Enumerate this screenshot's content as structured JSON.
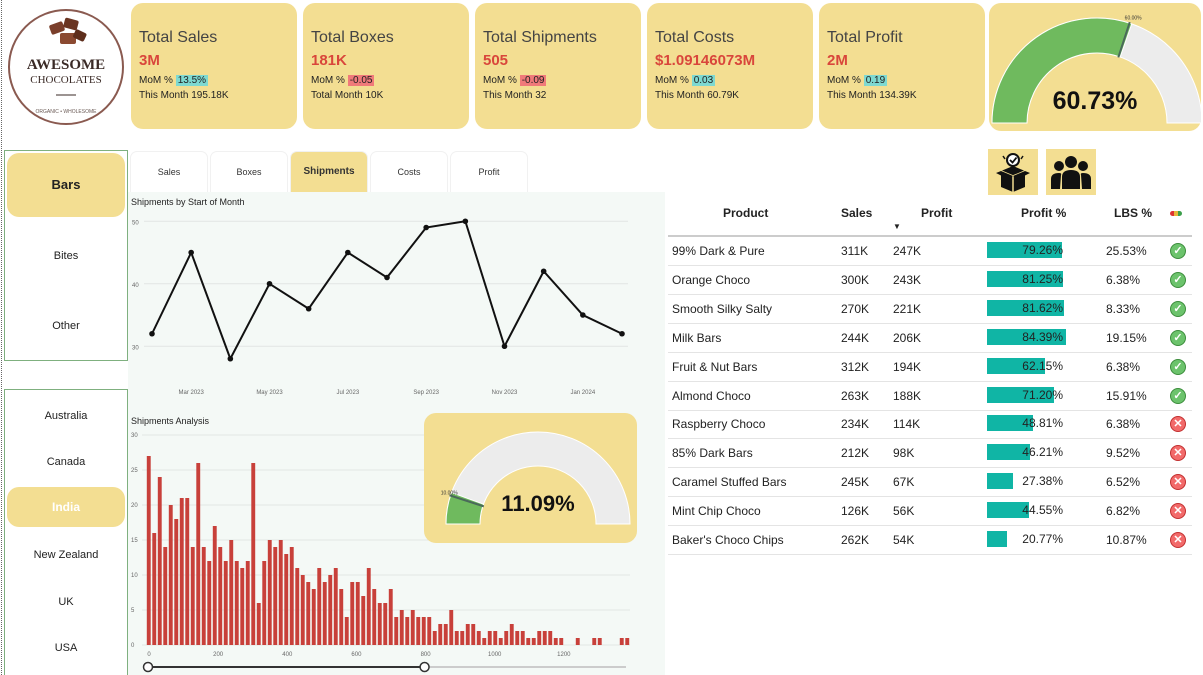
{
  "logo": {
    "line1": "AWESOME",
    "line2": "CHOCOLATES",
    "tagline": "ORGANIC • WHOLESOME"
  },
  "kpis": [
    {
      "title": "Total Sales",
      "value": "3M",
      "mom_label": "MoM %",
      "mom": "13.5%",
      "mom_dir": "pos",
      "this_month": "This Month 195.18K"
    },
    {
      "title": "Total Boxes",
      "value": "181K",
      "mom_label": "MoM %",
      "mom": "-0.05",
      "mom_dir": "neg",
      "this_month": "Total Month 10K"
    },
    {
      "title": "Total Shipments",
      "value": "505",
      "mom_label": "MoM %",
      "mom": "-0.09",
      "mom_dir": "neg",
      "this_month": "This Month 32"
    },
    {
      "title": "Total Costs",
      "value": "$1.09146073M",
      "mom_label": "MoM %",
      "mom": "0.03",
      "mom_dir": "pos",
      "this_month": "This Month 60.79K"
    },
    {
      "title": "Total Profit",
      "value": "2M",
      "mom_label": "MoM %",
      "mom": "0.19",
      "mom_dir": "pos",
      "this_month": "This Month 134.39K"
    }
  ],
  "gauge_main": {
    "value_label": "60.73%",
    "value": 0.6073,
    "target_label": "60.00%",
    "target": 0.6
  },
  "slicer_category": {
    "items": [
      "Bars",
      "Bites",
      "Other"
    ],
    "selected": "Bars"
  },
  "slicer_country": {
    "items": [
      "Australia",
      "Canada",
      "India",
      "New Zealand",
      "UK",
      "USA"
    ],
    "selected": "India"
  },
  "tabs": {
    "items": [
      "Sales",
      "Boxes",
      "Shipments",
      "Costs",
      "Profit"
    ],
    "selected": "Shipments"
  },
  "line_chart": {
    "title": "Shipments by Start of Month",
    "chart_data": {
      "type": "line",
      "x": [
        "Feb 2023",
        "Mar 2023",
        "Apr 2023",
        "May 2023",
        "Jun 2023",
        "Jul 2023",
        "Aug 2023",
        "Sep 2023",
        "Oct 2023",
        "Nov 2023",
        "Dec 2023",
        "Jan 2024",
        "Feb 2024"
      ],
      "values": [
        32,
        45,
        28,
        40,
        36,
        45,
        41,
        49,
        50,
        30,
        42,
        35,
        32
      ],
      "ylim": [
        27,
        51
      ],
      "yticks": [
        "30",
        "40",
        "50"
      ],
      "xticks": [
        "Mar 2023",
        "May 2023",
        "Jul 2023",
        "Sep 2023",
        "Nov 2023",
        "Jan 2024"
      ]
    }
  },
  "histogram": {
    "title": "Shipments Analysis",
    "chart_data": {
      "type": "bar",
      "xlim": [
        0,
        1400
      ],
      "ylim": [
        0,
        30
      ],
      "yticks": [
        "0",
        "5",
        "10",
        "15",
        "20",
        "25",
        "30"
      ],
      "xticks": [
        "0",
        "200",
        "400",
        "600",
        "800",
        "1000",
        "1200"
      ],
      "values": [
        27,
        16,
        24,
        14,
        20,
        18,
        21,
        21,
        14,
        26,
        14,
        12,
        17,
        14,
        12,
        15,
        12,
        11,
        12,
        26,
        6,
        12,
        15,
        14,
        15,
        13,
        14,
        11,
        10,
        9,
        8,
        11,
        9,
        10,
        11,
        8,
        4,
        9,
        9,
        7,
        11,
        8,
        6,
        6,
        8,
        4,
        5,
        4,
        5,
        4,
        4,
        4,
        2,
        3,
        3,
        5,
        2,
        2,
        3,
        3,
        2,
        1,
        2,
        2,
        1,
        2,
        3,
        2,
        2,
        1,
        1,
        2,
        2,
        2,
        1,
        1,
        0,
        0,
        1,
        0,
        0,
        1,
        1,
        0,
        0,
        0,
        1,
        1
      ],
      "slider": {
        "min": 0,
        "max": 800
      }
    }
  },
  "gauge_small": {
    "value_label": "11.09%",
    "value": 0.1109,
    "target_label": "10.00%",
    "target": 0.1
  },
  "table": {
    "headers": [
      "Product",
      "Sales",
      "Profit",
      "Profit %",
      "LBS %"
    ],
    "rows": [
      {
        "product": "99% Dark & Pure",
        "sales": "311K",
        "profit": "247K",
        "profit_pct": "79.26%",
        "pct": 79.26,
        "lbs": "25.53%",
        "ok": true
      },
      {
        "product": "Orange Choco",
        "sales": "300K",
        "profit": "243K",
        "profit_pct": "81.25%",
        "pct": 81.25,
        "lbs": "6.38%",
        "ok": true
      },
      {
        "product": "Smooth Silky Salty",
        "sales": "270K",
        "profit": "221K",
        "profit_pct": "81.62%",
        "pct": 81.62,
        "lbs": "8.33%",
        "ok": true
      },
      {
        "product": "Milk Bars",
        "sales": "244K",
        "profit": "206K",
        "profit_pct": "84.39%",
        "pct": 84.39,
        "lbs": "19.15%",
        "ok": true
      },
      {
        "product": "Fruit & Nut Bars",
        "sales": "312K",
        "profit": "194K",
        "profit_pct": "62.15%",
        "pct": 62.15,
        "lbs": "6.38%",
        "ok": true
      },
      {
        "product": "Almond Choco",
        "sales": "263K",
        "profit": "188K",
        "profit_pct": "71.20%",
        "pct": 71.2,
        "lbs": "15.91%",
        "ok": true
      },
      {
        "product": "Raspberry Choco",
        "sales": "234K",
        "profit": "114K",
        "profit_pct": "48.81%",
        "pct": 48.81,
        "lbs": "6.38%",
        "ok": false
      },
      {
        "product": "85% Dark Bars",
        "sales": "212K",
        "profit": "98K",
        "profit_pct": "46.21%",
        "pct": 46.21,
        "lbs": "9.52%",
        "ok": false
      },
      {
        "product": "Caramel Stuffed Bars",
        "sales": "245K",
        "profit": "67K",
        "profit_pct": "27.38%",
        "pct": 27.38,
        "lbs": "6.52%",
        "ok": false
      },
      {
        "product": "Mint Chip Choco",
        "sales": "126K",
        "profit": "56K",
        "profit_pct": "44.55%",
        "pct": 44.55,
        "lbs": "6.82%",
        "ok": false
      },
      {
        "product": "Baker's Choco Chips",
        "sales": "262K",
        "profit": "54K",
        "profit_pct": "20.77%",
        "pct": 20.77,
        "lbs": "10.87%",
        "ok": false
      }
    ]
  },
  "colors": {
    "card": "#f3de92",
    "bar_teal": "#10b5a5",
    "hist_red": "#c8403a",
    "gauge_green": "#6fba5e",
    "negative": "#f07a7a",
    "positive": "#7ed9d1"
  },
  "icons": [
    "box-check-icon",
    "users-icon"
  ]
}
